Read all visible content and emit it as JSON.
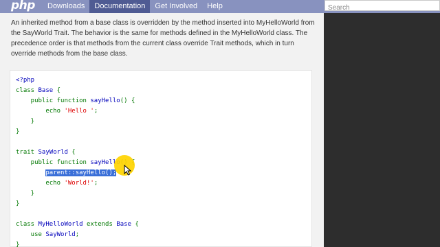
{
  "nav": {
    "logo": "php",
    "items": [
      {
        "label": "Downloads",
        "active": false
      },
      {
        "label": "Documentation",
        "active": true
      },
      {
        "label": "Get Involved",
        "active": false
      },
      {
        "label": "Help",
        "active": false
      }
    ],
    "search_placeholder": "Search"
  },
  "intro_text": "An inherited method from a base class is overridden by the method inserted into MyHelloWorld from the SayWorld Trait. The behavior is the same for methods defined in the MyHelloWorld class. The precedence order is that methods from the current class override Trait methods, which in turn override methods from the base class.",
  "code": {
    "lines": [
      [
        {
          "t": "<?php",
          "c": "tag"
        }
      ],
      [
        {
          "t": "class ",
          "c": "kw"
        },
        {
          "t": "Base ",
          "c": "plain"
        },
        {
          "t": "{",
          "c": "kw"
        }
      ],
      [
        {
          "t": "    public function ",
          "c": "kw"
        },
        {
          "t": "sayHello",
          "c": "plain"
        },
        {
          "t": "() {",
          "c": "kw"
        }
      ],
      [
        {
          "t": "        echo ",
          "c": "kw"
        },
        {
          "t": "'Hello '",
          "c": "str"
        },
        {
          "t": ";",
          "c": "kw"
        }
      ],
      [
        {
          "t": "    }",
          "c": "kw"
        }
      ],
      [
        {
          "t": "}",
          "c": "kw"
        }
      ],
      [
        {
          "t": "",
          "c": "kw"
        }
      ],
      [
        {
          "t": "trait ",
          "c": "kw"
        },
        {
          "t": "SayWorld ",
          "c": "plain"
        },
        {
          "t": "{",
          "c": "kw"
        }
      ],
      [
        {
          "t": "    public function ",
          "c": "kw"
        },
        {
          "t": "sayHello",
          "c": "plain"
        },
        {
          "t": "() {",
          "c": "kw"
        }
      ],
      [
        {
          "t": "        ",
          "c": "kw"
        },
        {
          "t": "parent::sayHello();",
          "c": "sel"
        }
      ],
      [
        {
          "t": "        echo ",
          "c": "kw"
        },
        {
          "t": "'World!'",
          "c": "str"
        },
        {
          "t": ";",
          "c": "kw"
        }
      ],
      [
        {
          "t": "    }",
          "c": "kw"
        }
      ],
      [
        {
          "t": "}",
          "c": "kw"
        }
      ],
      [
        {
          "t": "",
          "c": "kw"
        }
      ],
      [
        {
          "t": "class ",
          "c": "kw"
        },
        {
          "t": "MyHelloWorld ",
          "c": "plain"
        },
        {
          "t": "extends ",
          "c": "kw"
        },
        {
          "t": "Base ",
          "c": "plain"
        },
        {
          "t": "{",
          "c": "kw"
        }
      ],
      [
        {
          "t": "    use ",
          "c": "kw"
        },
        {
          "t": "SayWorld",
          "c": "plain"
        },
        {
          "t": ";",
          "c": "kw"
        }
      ],
      [
        {
          "t": "}",
          "c": "kw"
        }
      ]
    ]
  },
  "colors": {
    "nav_bg": "#8892bf",
    "nav_active": "#4f5b93",
    "keyword": "#007700",
    "string": "#dd0000",
    "identifier": "#0000bb",
    "selection": "#3a6fd8",
    "cursor_highlight": "#ffd400"
  },
  "icons": {
    "cursor": "arrow-cursor-icon"
  }
}
